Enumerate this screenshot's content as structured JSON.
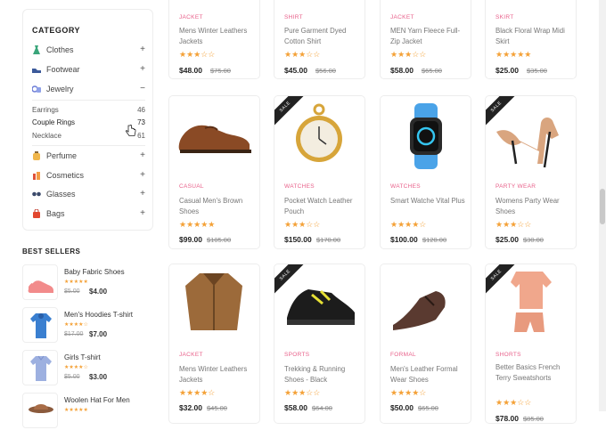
{
  "sidebar": {
    "category_title": "CATEGORY",
    "categories": [
      {
        "label": "Clothes",
        "sign": "+",
        "icon": "dress-icon"
      },
      {
        "label": "Footwear",
        "sign": "+",
        "icon": "shoe-icon"
      },
      {
        "label": "Jewelry",
        "sign": "−",
        "icon": "jewelry-icon"
      },
      {
        "label": "Perfume",
        "sign": "+",
        "icon": "perfume-icon"
      },
      {
        "label": "Cosmetics",
        "sign": "+",
        "icon": "cosmetics-icon"
      },
      {
        "label": "Glasses",
        "sign": "+",
        "icon": "glasses-icon"
      },
      {
        "label": "Bags",
        "sign": "+",
        "icon": "bag-icon"
      }
    ],
    "jewelry_sub": [
      {
        "label": "Earrings",
        "count": "46"
      },
      {
        "label": "Couple Rings",
        "count": "73"
      },
      {
        "label": "Necklace",
        "count": "61"
      }
    ]
  },
  "best_sellers": {
    "title": "BEST SELLERS",
    "items": [
      {
        "name": "Baby Fabric Shoes",
        "stars": "★★★★★",
        "old": "$5.00",
        "price": "$4.00"
      },
      {
        "name": "Men's Hoodies T-shirt",
        "stars": "★★★★☆",
        "old": "$17.00",
        "price": "$7.00"
      },
      {
        "name": "Girls T-shirt",
        "stars": "★★★★☆",
        "old": "$5.00",
        "price": "$3.00"
      },
      {
        "name": "Woolen Hat For Men",
        "stars": "★★★★★",
        "old": "",
        "price": ""
      }
    ]
  },
  "products": [
    {
      "category": "JACKET",
      "name": "Mens Winter Leathers Jackets",
      "stars": "★★★☆☆",
      "price": "$48.00",
      "old": "$75.00",
      "sale": false
    },
    {
      "category": "SHIRT",
      "name": "Pure Garment Dyed Cotton Shirt",
      "stars": "★★★☆☆",
      "price": "$45.00",
      "old": "$56.00",
      "sale": false
    },
    {
      "category": "JACKET",
      "name": "MEN Yarn Fleece Full-Zip Jacket",
      "stars": "★★★☆☆",
      "price": "$58.00",
      "old": "$65.00",
      "sale": false
    },
    {
      "category": "SKIRT",
      "name": "Black Floral Wrap Midi Skirt",
      "stars": "★★★★★",
      "price": "$25.00",
      "old": "$35.00",
      "sale": false
    },
    {
      "category": "CASUAL",
      "name": "Casual Men's Brown Shoes",
      "stars": "★★★★★",
      "price": "$99.00",
      "old": "$105.00",
      "sale": false
    },
    {
      "category": "WATCHES",
      "name": "Pocket Watch Leather Pouch",
      "stars": "★★★☆☆",
      "price": "$150.00",
      "old": "$170.00",
      "sale": true
    },
    {
      "category": "WATCHES",
      "name": "Smart Watche Vital Plus",
      "stars": "★★★★☆",
      "price": "$100.00",
      "old": "$120.00",
      "sale": false
    },
    {
      "category": "PARTY WEAR",
      "name": "Womens Party Wear Shoes",
      "stars": "★★★☆☆",
      "price": "$25.00",
      "old": "$30.00",
      "sale": true
    },
    {
      "category": "JACKET",
      "name": "Mens Winter Leathers Jackets",
      "stars": "★★★★☆",
      "price": "$32.00",
      "old": "$45.00",
      "sale": false
    },
    {
      "category": "SPORTS",
      "name": "Trekking & Running Shoes - Black",
      "stars": "★★★☆☆",
      "price": "$58.00",
      "old": "$64.00",
      "sale": true
    },
    {
      "category": "FORMAL",
      "name": "Men's Leather Formal Wear Shoes",
      "stars": "★★★★☆",
      "price": "$50.00",
      "old": "$65.00",
      "sale": false
    },
    {
      "category": "SHORTS",
      "name": "Better Basics French Terry Sweatshorts",
      "stars": "★★★☆☆",
      "price": "$78.00",
      "old": "$85.00",
      "sale": true
    }
  ],
  "sale_label": "SALE",
  "colors": {
    "accent": "#e8608a",
    "star": "#f4a137"
  }
}
